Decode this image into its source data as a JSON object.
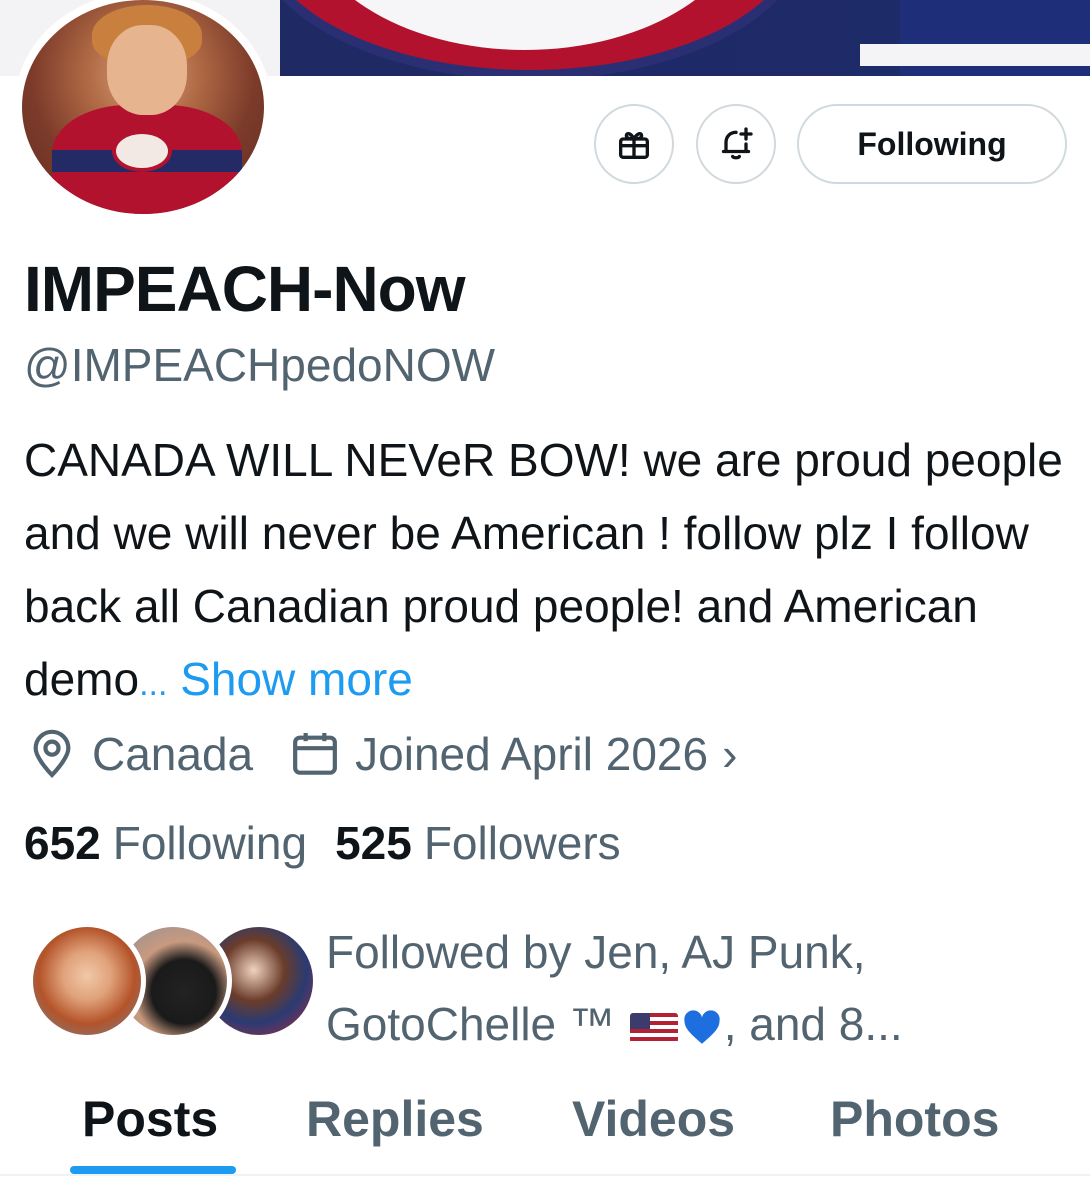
{
  "profile": {
    "display_name": "IMPEACH-Now",
    "handle": "@IMPEACHpedoNOW",
    "bio": "CANADA WILL NEVeR BOW! we are proud people and we will never be American ! follow plz I follow back all Canadian proud people! and American demo",
    "bio_ellipsis": "...",
    "show_more": "Show more",
    "location": "Canada",
    "joined": "Joined April 2026",
    "following_count": "652",
    "following_label": "Following",
    "followers_count": "525",
    "followers_label": "Followers"
  },
  "actions": {
    "follow_button": "Following",
    "gift_icon": "gift-icon",
    "notify_icon": "bell-plus-icon"
  },
  "followed_by": {
    "prefix": "Followed by Jen, AJ Punk,",
    "line2_name": "GotoChelle ™",
    "suffix": ", and 8..."
  },
  "tabs": [
    {
      "label": "Posts",
      "active": true
    },
    {
      "label": "Replies",
      "active": false
    },
    {
      "label": "Videos",
      "active": false
    },
    {
      "label": "Photos",
      "active": false
    }
  ],
  "colors": {
    "accent": "#1d9bf0",
    "text_primary": "#0f1419",
    "text_secondary": "#536471",
    "border": "#cfd9de"
  }
}
